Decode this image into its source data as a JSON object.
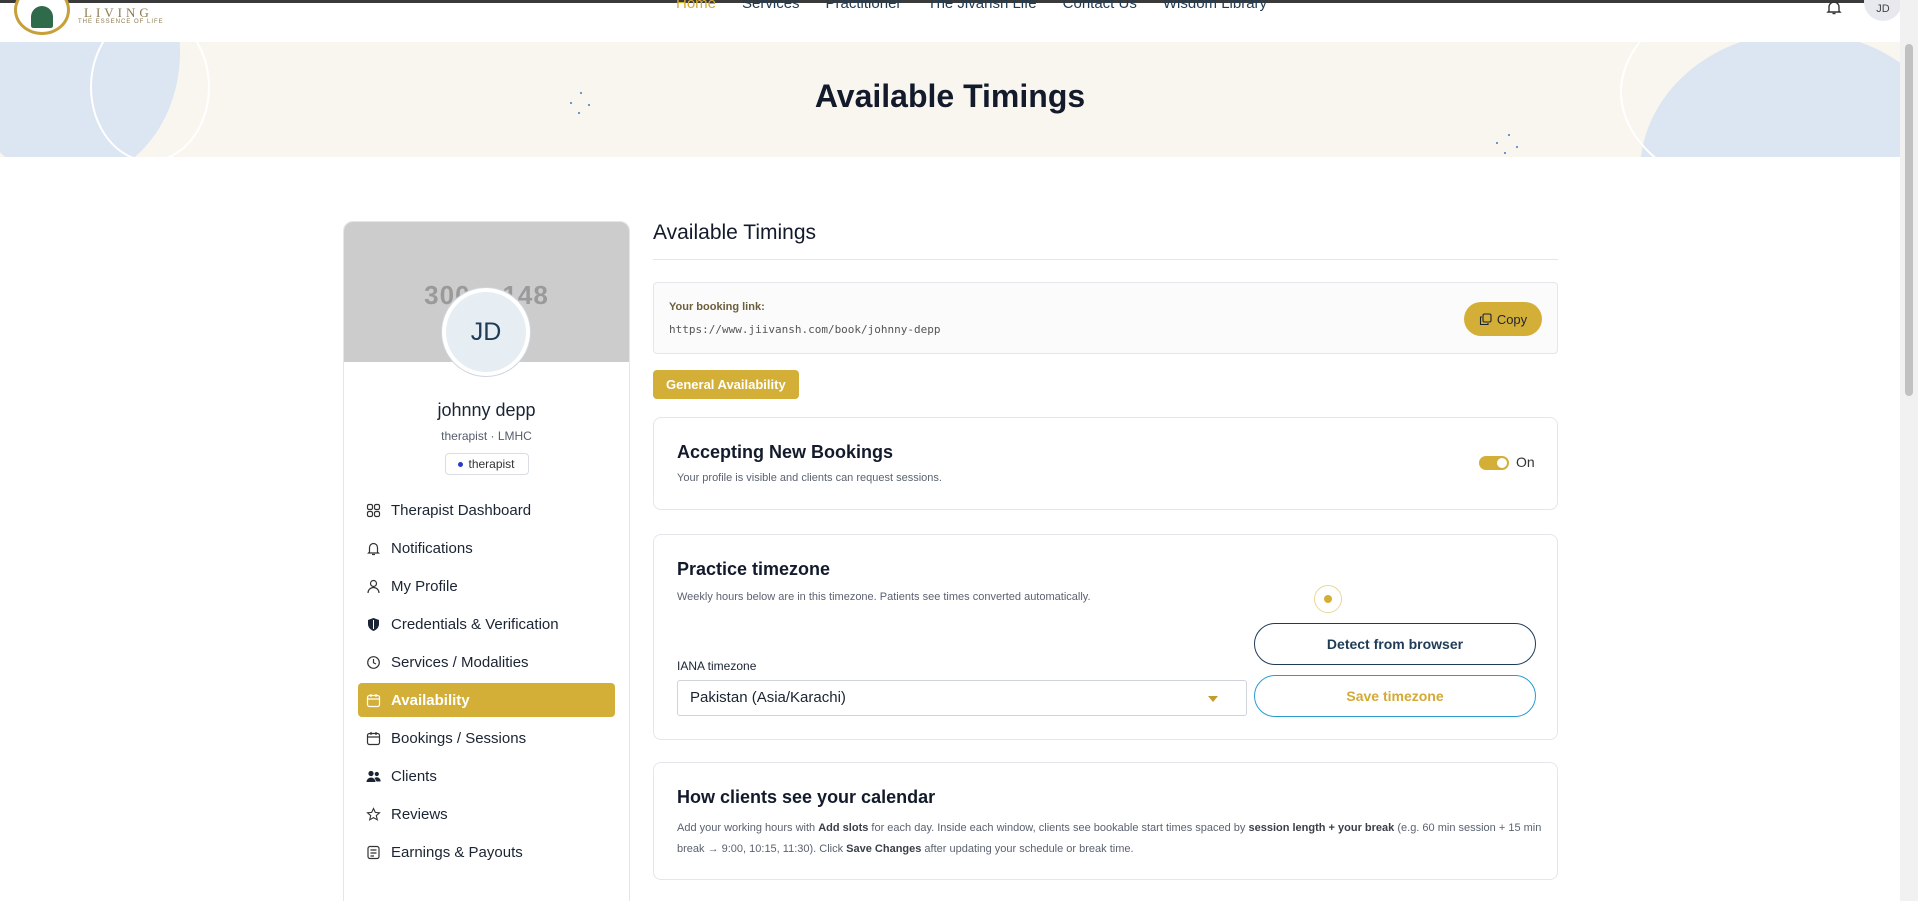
{
  "brand": {
    "word": "LIVING",
    "tagline": "THE ESSENCE OF LIFE"
  },
  "nav": {
    "items": [
      {
        "label": "Home",
        "active": true
      },
      {
        "label": "Services"
      },
      {
        "label": "Practitioner"
      },
      {
        "label": "The Jivansh Life"
      },
      {
        "label": "Contact Us"
      },
      {
        "label": "Wisdom Library"
      }
    ],
    "avatar_initials": "JD"
  },
  "hero": {
    "title": "Available Timings"
  },
  "profile": {
    "cover_placeholder": "300 x 148",
    "initials": "JD",
    "name": "johnny depp",
    "role": "therapist · LMHC",
    "badge": "therapist"
  },
  "sidebar": {
    "items": [
      {
        "label": "Therapist Dashboard",
        "icon": "dashboard-icon"
      },
      {
        "label": "Notifications",
        "icon": "bell-icon"
      },
      {
        "label": "My Profile",
        "icon": "user-icon"
      },
      {
        "label": "Credentials & Verification",
        "icon": "shield-icon"
      },
      {
        "label": "Services / Modalities",
        "icon": "clock-icon"
      },
      {
        "label": "Availability",
        "icon": "calendar-icon",
        "active": true
      },
      {
        "label": "Bookings / Sessions",
        "icon": "calendar-icon"
      },
      {
        "label": "Clients",
        "icon": "users-icon"
      },
      {
        "label": "Reviews",
        "icon": "star-icon"
      },
      {
        "label": "Earnings & Payouts",
        "icon": "wallet-icon"
      }
    ]
  },
  "main": {
    "title": "Available Timings",
    "booking": {
      "label": "Your booking link:",
      "url": "https://www.jiivansh.com/book/johnny-depp",
      "copy_label": "Copy"
    },
    "tab_label": "General Availability",
    "accepting": {
      "title": "Accepting New Bookings",
      "desc": "Your profile is visible and clients can request sessions.",
      "toggle_label": "On"
    },
    "timezone": {
      "title": "Practice timezone",
      "desc": "Weekly hours below are in this timezone. Patients see times converted automatically.",
      "field_label": "IANA timezone",
      "value": "Pakistan (Asia/Karachi)",
      "detect_label": "Detect from browser",
      "save_label": "Save timezone"
    },
    "calendar": {
      "title": "How clients see your calendar",
      "p1": "Add your working hours with ",
      "b1": "Add slots",
      "p2": " for each day. Inside each window, clients see bookable start times spaced by ",
      "b2": "session length + your break",
      "p3": " (e.g. 60 min session + 15 min break → 9:00, 10:15, 11:30). Click ",
      "b3": "Save Changes",
      "p4": " after updating your schedule or break time."
    }
  },
  "colors": {
    "accent": "#d4af37",
    "navy": "#1f3c57",
    "hero_bg": "#f8f6ef"
  }
}
